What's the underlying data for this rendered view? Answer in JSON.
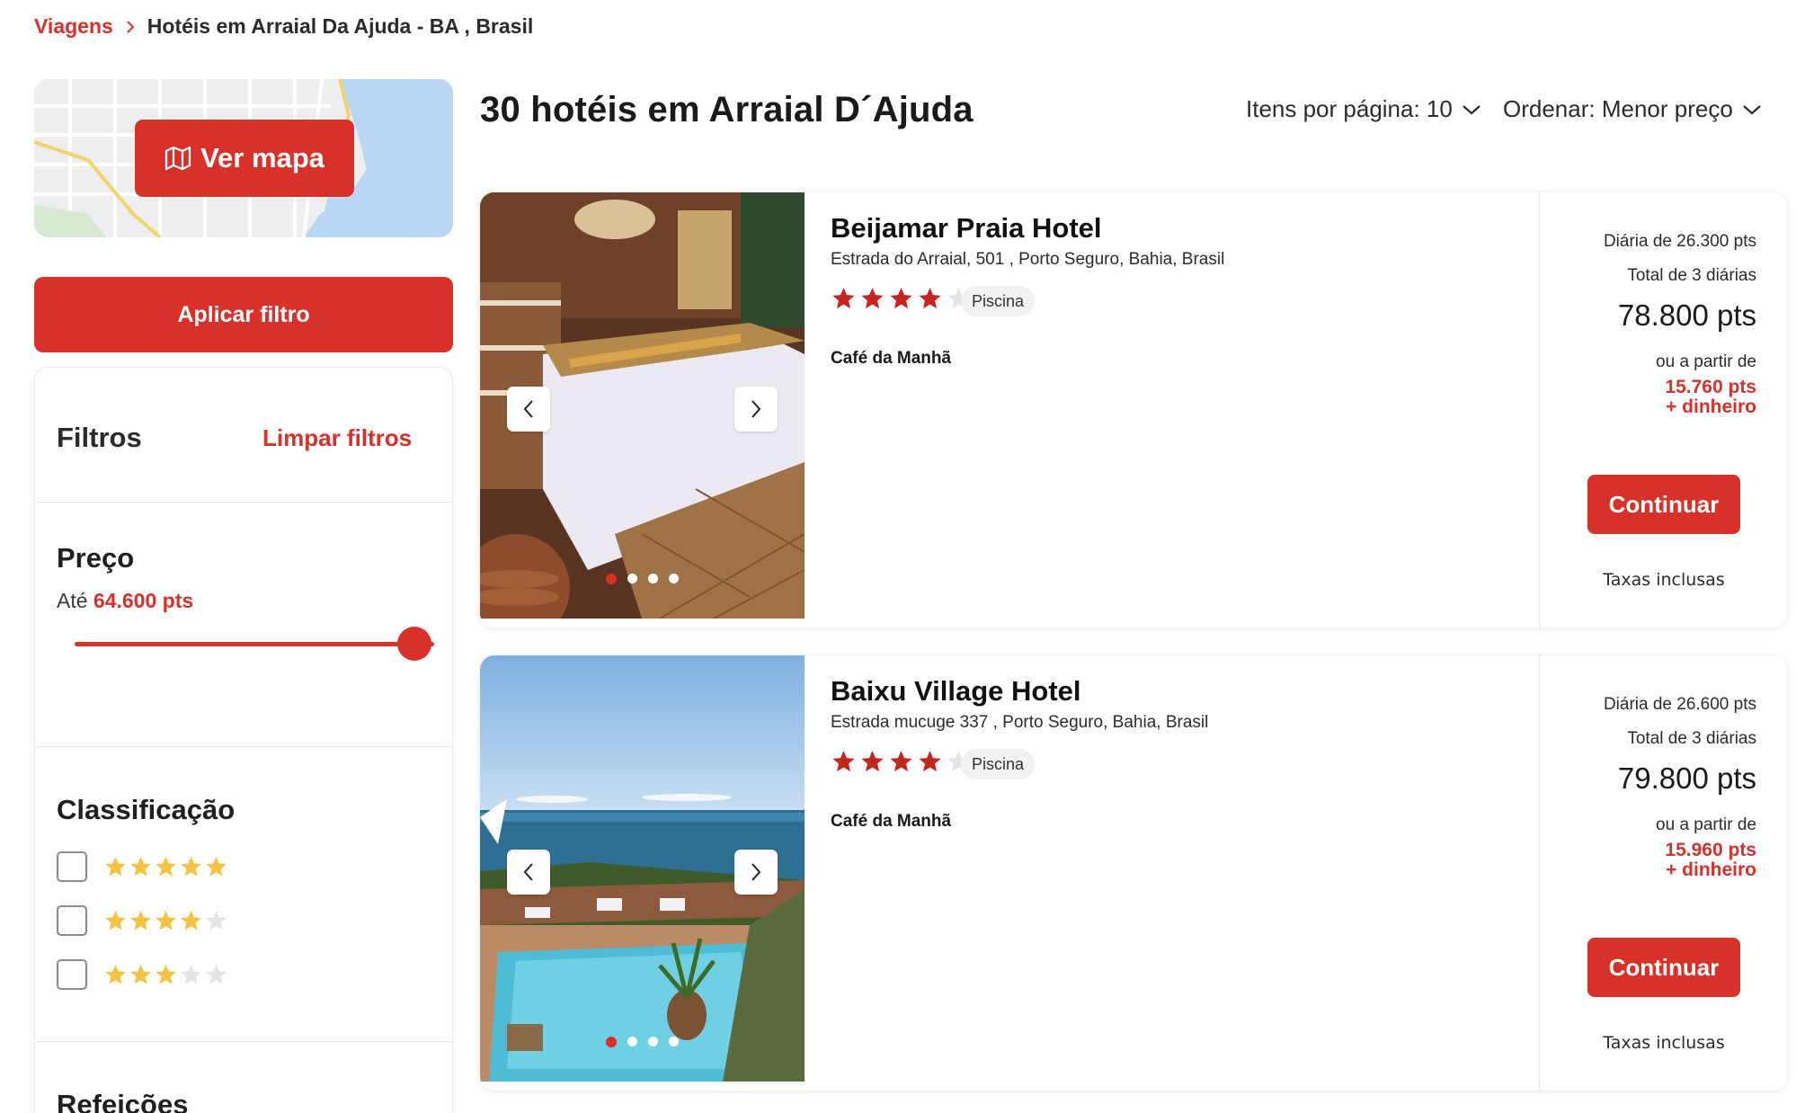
{
  "breadcrumb": {
    "link": "Viagens",
    "current": "Hotéis em Arraial Da Ajuda - BA , Brasil"
  },
  "sidebar": {
    "map_button": "Ver mapa",
    "apply_button": "Aplicar filtro",
    "filters_title": "Filtros",
    "clear_filters": "Limpar filtros",
    "price": {
      "title": "Preço",
      "prefix": "Até",
      "value": "64.600 pts",
      "slider_fraction": 1.0
    },
    "rating": {
      "title": "Classificação",
      "options": [
        {
          "stars": 5,
          "checked": false
        },
        {
          "stars": 4,
          "checked": false
        },
        {
          "stars": 3,
          "checked": false
        }
      ]
    },
    "meals": {
      "title": "Refeições"
    }
  },
  "main": {
    "results_title": "30 hotéis em Arraial D´Ajuda",
    "per_page_label": "Itens por página: 10",
    "sort_label": "Ordenar: Menor preço"
  },
  "hotels": [
    {
      "name": "Beijamar Praia Hotel",
      "address": "Estrada do Arraial, 501 , Porto Seguro, Bahia, Brasil",
      "stars": 4,
      "amenity": "Piscina",
      "meal": "Café da Manhã",
      "daily": "Diária de 26.300 pts",
      "total_nights": "Total de 3 diárias",
      "total_price": "78.800 pts",
      "from_label": "ou a partir de",
      "from_pts": "15.760 pts",
      "from_cash": "+ dinheiro",
      "continue": "Continuar",
      "taxes": "Taxas inclusas",
      "photo_count": 4,
      "active_photo": 1
    },
    {
      "name": "Baixu Village Hotel",
      "address": "Estrada mucuge 337 , Porto Seguro, Bahia, Brasil",
      "stars": 4,
      "amenity": "Piscina",
      "meal": "Café da Manhã",
      "daily": "Diária de 26.600 pts",
      "total_nights": "Total de 3 diárias",
      "total_price": "79.800 pts",
      "from_label": "ou a partir de",
      "from_pts": "15.960 pts",
      "from_cash": "+ dinheiro",
      "continue": "Continuar",
      "taxes": "Taxas inclusas",
      "photo_count": 4,
      "active_photo": 1
    }
  ],
  "colors": {
    "brand": "#d8312a",
    "star_red": "#c4261f",
    "star_yellow": "#f5c242",
    "star_empty": "#e4e4e4"
  }
}
